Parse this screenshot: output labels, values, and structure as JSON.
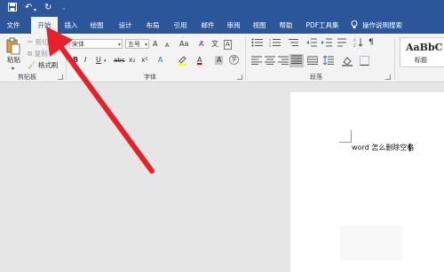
{
  "quick_access": {
    "save_icon": "save-icon",
    "undo_icon": "undo-icon",
    "redo_icon": "redo-icon",
    "customize_icon": "customize-icon"
  },
  "tabs": [
    {
      "label": "文件",
      "active": false
    },
    {
      "label": "开始",
      "active": true
    },
    {
      "label": "插入",
      "active": false
    },
    {
      "label": "绘图",
      "active": false
    },
    {
      "label": "设计",
      "active": false
    },
    {
      "label": "布局",
      "active": false
    },
    {
      "label": "引用",
      "active": false
    },
    {
      "label": "邮件",
      "active": false
    },
    {
      "label": "审阅",
      "active": false
    },
    {
      "label": "视图",
      "active": false
    },
    {
      "label": "帮助",
      "active": false
    },
    {
      "label": "PDF工具集",
      "active": false
    }
  ],
  "tell_me": {
    "label": "操作说明搜索",
    "icon": "lightbulb-icon"
  },
  "clipboard": {
    "paste_label": "粘贴",
    "cut_label": "剪切",
    "copy_label": "复制",
    "format_painter_label": "格式刷",
    "group_label": "剪贴板"
  },
  "font": {
    "font_name": "宋体",
    "font_size": "五号",
    "group_label": "字体",
    "grow_label": "A",
    "shrink_label": "A",
    "case_label": "Aa",
    "bold": "B",
    "italic": "I",
    "underline": "U",
    "strike": "abc",
    "subscript": "x₂",
    "superscript": "x²",
    "effects": "A",
    "font_color": "A",
    "char_shading": "A",
    "char_border": "A"
  },
  "paragraph": {
    "group_label": "段落"
  },
  "styles": {
    "sample": "AaBbC",
    "name": "标题"
  },
  "document": {
    "text": "word 怎么删除空格"
  },
  "colors": {
    "accent": "#2b579a",
    "arrow": "#e8202a",
    "highlight": "#ffff00",
    "font_color": "#e00000"
  }
}
